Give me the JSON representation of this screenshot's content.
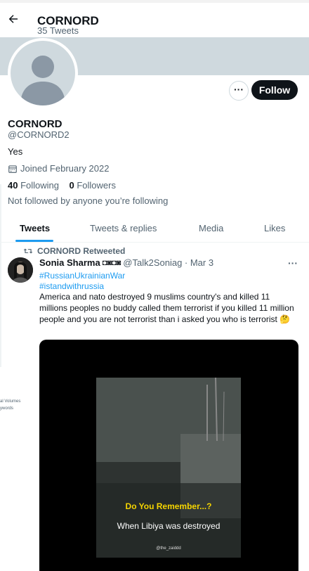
{
  "header": {
    "name": "CORNORD",
    "tweet_count": "35 Tweets"
  },
  "profile": {
    "name": "CORNORD",
    "handle": "@CORNORD2",
    "bio": "Yes",
    "joined": "Joined February 2022",
    "following_count": "40",
    "following_label": "Following",
    "followers_count": "0",
    "followers_label": "Followers",
    "note": "Not followed by anyone you’re following",
    "follow_label": "Follow",
    "more_label": "···"
  },
  "tabs": [
    "Tweets",
    "Tweets & replies",
    "Media",
    "Likes"
  ],
  "tweet": {
    "retweet_label": "CORNORD Retweeted",
    "author": "Sonia Sharma",
    "author_badges": "◘◙◘◙",
    "handle_date": "@Talk2Soniag · Mar 3",
    "more": "···",
    "hashtag1": "#RussianUkrainianWar",
    "hashtag2": "#istandwithrussia",
    "text": "America and nato destroyed 9 muslims country's and killed 11 millions peoples no buddy called them terrorist if you killed 11 million people and you are not terrorist than i asked you who is terrorist 🤔",
    "video_line1": "Do You Remember...?",
    "video_line2": "When Libiya was destroyed",
    "video_watermark": "@the_zaiddd"
  },
  "side_text": {
    "line1": "al Volumes",
    "line2": "ywords"
  },
  "colors": {
    "accent": "#1d9bf0",
    "text": "#0f1419",
    "muted": "#536471",
    "banner": "#cfd9de"
  }
}
